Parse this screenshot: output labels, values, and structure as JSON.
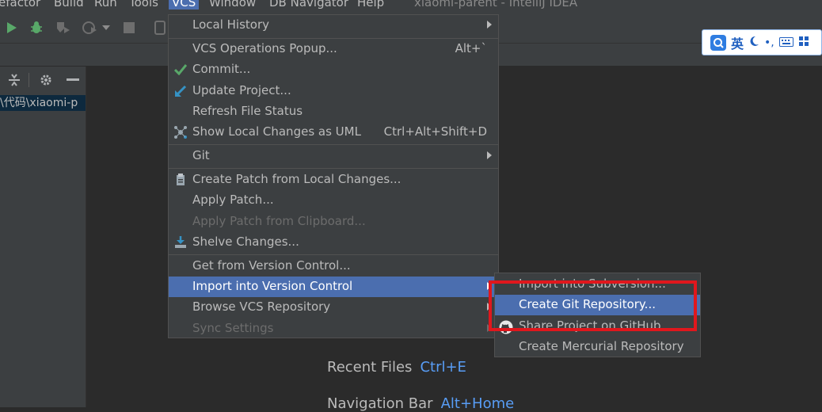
{
  "menubar": {
    "items": [
      "efactor",
      "Build",
      "Run",
      "Tools",
      "VCS",
      "Window",
      "DB Navigator",
      "Help"
    ],
    "window_title": "xiaomi-parent - IntelliJ IDEA"
  },
  "toolbar": {
    "icons": [
      "run-icon",
      "debug-icon",
      "coverage-icon",
      "profile-icon",
      "stop-icon",
      "device-icon"
    ]
  },
  "project": {
    "path_label": "\\代码\\xiaomi-p"
  },
  "ime": {
    "language": "英"
  },
  "vcs_menu": {
    "items": [
      {
        "label": "Local History",
        "submenu": true
      },
      {
        "label": "VCS Operations Popup...",
        "shortcut": "Alt+`"
      },
      {
        "label": "Commit...",
        "icon": "check-icon"
      },
      {
        "label": "Update Project...",
        "icon": "update-arrow-icon"
      },
      {
        "label": "Refresh File Status"
      },
      {
        "label": "Show Local Changes as UML",
        "shortcut": "Ctrl+Alt+Shift+D",
        "icon": "uml-icon"
      },
      {
        "label": "Git",
        "submenu": true
      },
      {
        "label": "Create Patch from Local Changes...",
        "icon": "patch-icon"
      },
      {
        "label": "Apply Patch..."
      },
      {
        "label": "Apply Patch from Clipboard...",
        "disabled": true
      },
      {
        "label": "Shelve Changes...",
        "icon": "shelve-icon"
      },
      {
        "label": "Get from Version Control..."
      },
      {
        "label": "Import into Version Control",
        "submenu": true,
        "selected": true
      },
      {
        "label": "Browse VCS Repository",
        "submenu": true
      },
      {
        "label": "Sync Settings",
        "disabled": true,
        "submenu": true
      }
    ]
  },
  "import_submenu": {
    "items": [
      {
        "label": "Import into Subversion..."
      },
      {
        "label": "Create Git Repository...",
        "selected": true
      },
      {
        "label": "Share Project on GitHub",
        "icon": "github-icon"
      },
      {
        "label": "Create Mercurial Repository"
      }
    ]
  },
  "welcome": {
    "recent_files_label": "Recent Files",
    "recent_files_shortcut": "Ctrl+E",
    "navigation_bar_label": "Navigation Bar",
    "navigation_bar_shortcut": "Alt+Home"
  },
  "colors": {
    "menu_bg": "#3c3f41",
    "selection": "#4b6eaf",
    "highlight_box": "#e0171d",
    "shortcut_blue": "#589df6"
  }
}
